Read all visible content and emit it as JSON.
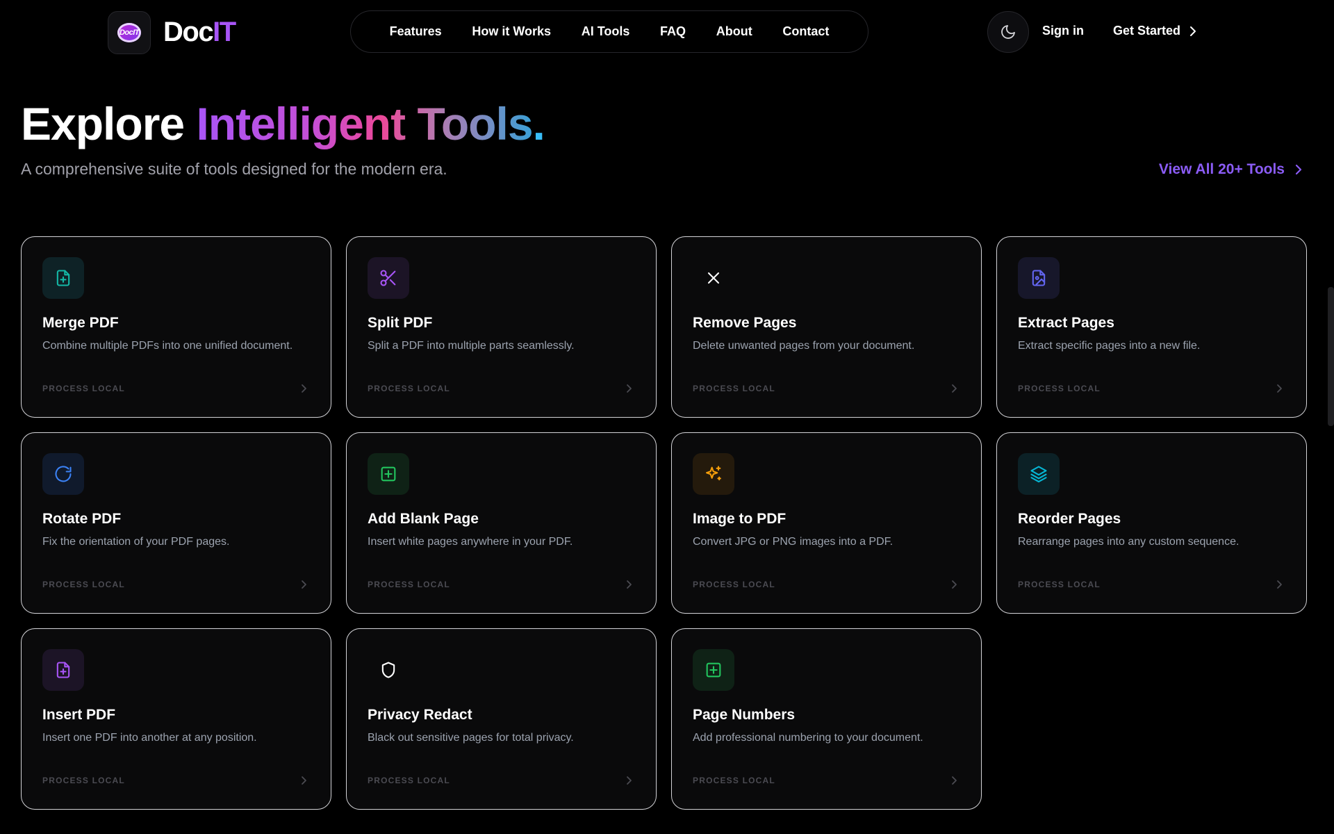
{
  "brand": {
    "logo_text": "DocIT",
    "name_part1": "Doc",
    "name_part2": "IT"
  },
  "nav": [
    "Features",
    "How it Works",
    "AI Tools",
    "FAQ",
    "About",
    "Contact"
  ],
  "header": {
    "signin": "Sign in",
    "get_started": "Get Started"
  },
  "hero": {
    "title_plain": "Explore ",
    "title_gradient": "Intelligent Tools",
    "title_dot": ".",
    "subtitle": "A comprehensive suite of tools designed for the modern era.",
    "view_all": "View All 20+ Tools"
  },
  "cards": [
    {
      "title": "Merge PDF",
      "desc": "Combine multiple PDFs into one unified document.",
      "footer": "PROCESS LOCAL",
      "icon": "file-plus-icon",
      "color": "#14b8a6",
      "tile": "#0e2226"
    },
    {
      "title": "Split PDF",
      "desc": "Split a PDF into multiple parts seamlessly.",
      "footer": "PROCESS LOCAL",
      "icon": "scissors-icon",
      "color": "#a855f7",
      "tile": "#1c1426"
    },
    {
      "title": "Remove Pages",
      "desc": "Delete unwanted pages from your document.",
      "footer": "PROCESS LOCAL",
      "icon": "x-icon",
      "color": "#ffffff",
      "tile": "transparent"
    },
    {
      "title": "Extract Pages",
      "desc": "Extract specific pages into a new file.",
      "footer": "PROCESS LOCAL",
      "icon": "file-image-icon",
      "color": "#6366f1",
      "tile": "#17172a"
    },
    {
      "title": "Rotate PDF",
      "desc": "Fix the orientation of your PDF pages.",
      "footer": "PROCESS LOCAL",
      "icon": "rotate-icon",
      "color": "#3b82f6",
      "tile": "#101a2c"
    },
    {
      "title": "Add Blank Page",
      "desc": "Insert white pages anywhere in your PDF.",
      "footer": "PROCESS LOCAL",
      "icon": "square-plus-icon",
      "color": "#22c55e",
      "tile": "#0f2216"
    },
    {
      "title": "Image to PDF",
      "desc": "Convert JPG or PNG images into a PDF.",
      "footer": "PROCESS LOCAL",
      "icon": "sparkles-icon",
      "color": "#f59e0b",
      "tile": "#241a0c"
    },
    {
      "title": "Reorder Pages",
      "desc": "Rearrange pages into any custom sequence.",
      "footer": "PROCESS LOCAL",
      "icon": "layers-icon",
      "color": "#06b6d4",
      "tile": "#0c2126"
    },
    {
      "title": "Insert PDF",
      "desc": "Insert one PDF into another at any position.",
      "footer": "PROCESS LOCAL",
      "icon": "file-plus-icon",
      "color": "#a855f7",
      "tile": "#1c1426"
    },
    {
      "title": "Privacy Redact",
      "desc": "Black out sensitive pages for total privacy.",
      "footer": "PROCESS LOCAL",
      "icon": "shield-icon",
      "color": "#ffffff",
      "tile": "transparent"
    },
    {
      "title": "Page Numbers",
      "desc": "Add professional numbering to your document.",
      "footer": "PROCESS LOCAL",
      "icon": "square-plus-icon",
      "color": "#22c55e",
      "tile": "#0f2216"
    }
  ]
}
